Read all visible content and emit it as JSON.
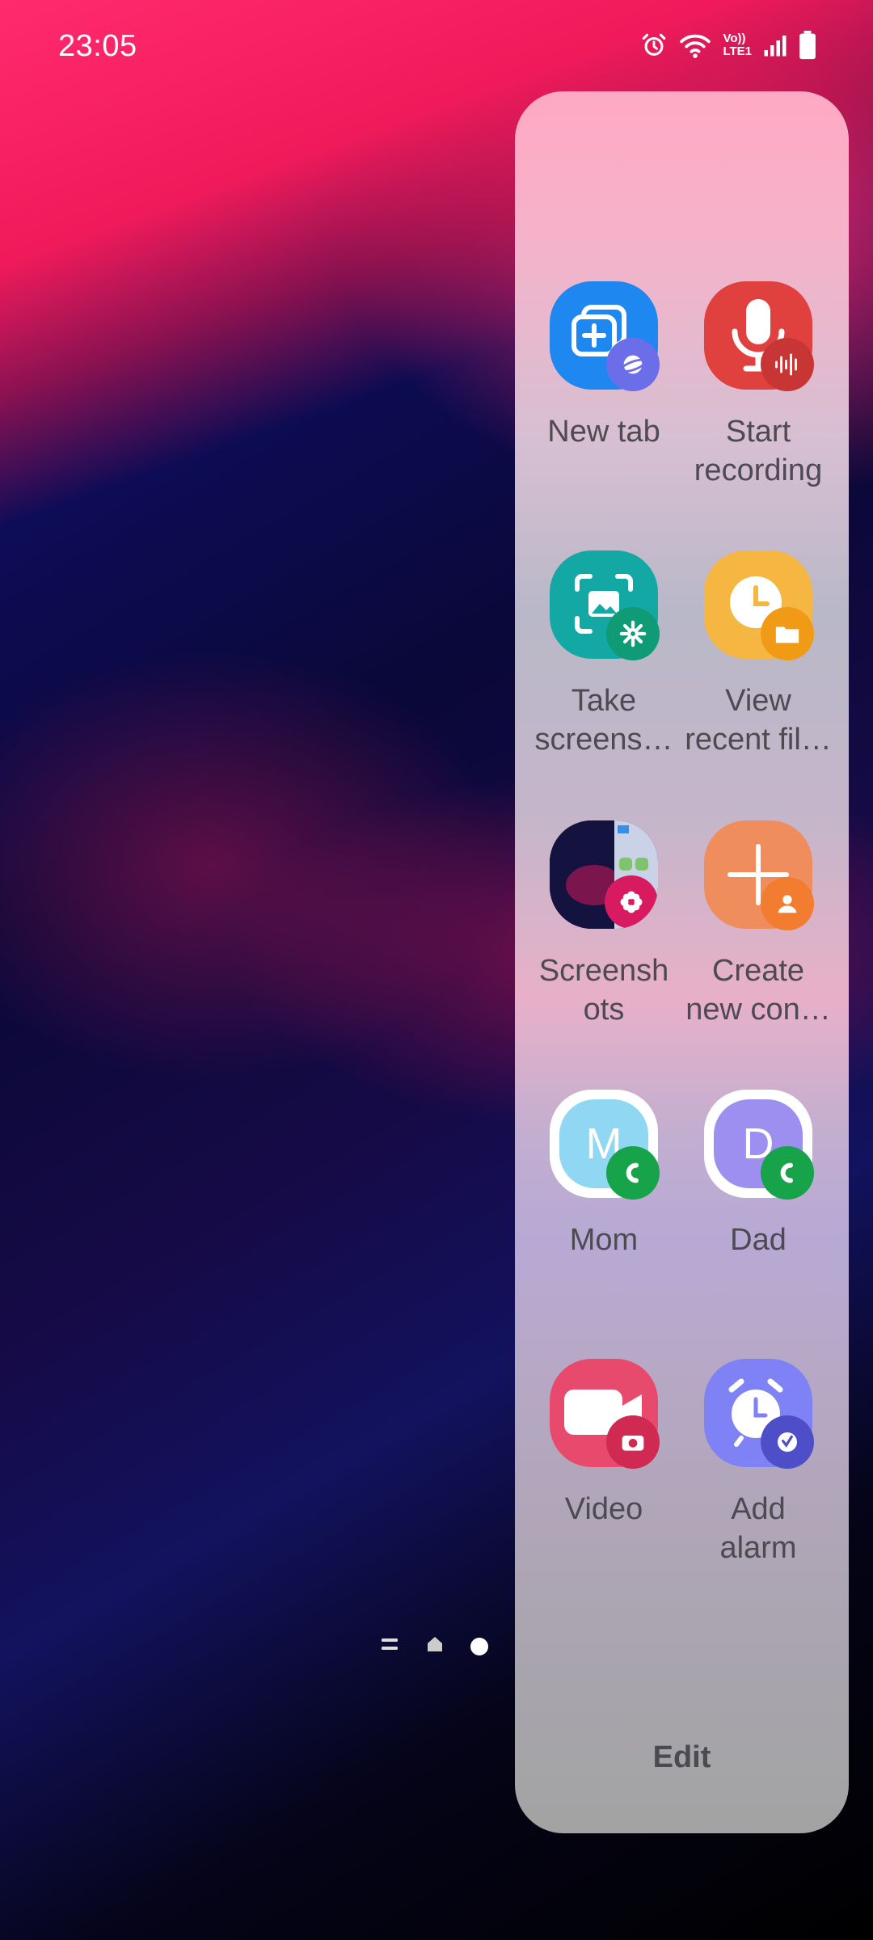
{
  "status_bar": {
    "time": "23:05",
    "icons": [
      "alarm-icon",
      "wifi-icon",
      "volte-icon",
      "signal-icon",
      "battery-icon"
    ],
    "volte_line1": "Vo))",
    "volte_line2": "LTE1"
  },
  "edge_panel": {
    "apps": [
      {
        "label": "New tab",
        "icon": "internet-new-tab-icon",
        "badge": "internet-icon",
        "color": "#1e88f0",
        "badge_color": "#6b6ee8"
      },
      {
        "label": "Start recording",
        "icon": "microphone-icon",
        "badge": "audio-wave-icon",
        "color": "#e0403e",
        "badge_color": "#c73535"
      },
      {
        "label": "Take screens…",
        "icon": "screenshot-icon",
        "badge": "gear-icon",
        "color": "#14a8a4",
        "badge_color": "#0f9b76"
      },
      {
        "label": "View recent fil…",
        "icon": "clock-icon",
        "badge": "folder-icon",
        "color": "#f5b642",
        "badge_color": "#f19a16"
      },
      {
        "label": "Screensh ots",
        "icon": "screenshot-thumbnail-icon",
        "badge": "flower-icon",
        "color": "#1c1450",
        "badge_color": "#d81b60"
      },
      {
        "label": "Create new con…",
        "icon": "plus-icon",
        "badge": "person-icon",
        "color": "#ef8e5c",
        "badge_color": "#f27c2f"
      },
      {
        "label": "Mom",
        "icon": "contact-avatar-icon",
        "initial": "M",
        "badge": "phone-icon",
        "color": "#8fd7f2",
        "badge_color": "#16a34a"
      },
      {
        "label": "Dad",
        "icon": "contact-avatar-icon",
        "initial": "D",
        "badge": "phone-icon",
        "color": "#9c8ff0",
        "badge_color": "#16a34a"
      },
      {
        "label": "Video",
        "icon": "video-camera-icon",
        "badge": "camera-icon",
        "color": "#e84a6e",
        "badge_color": "#d02a52"
      },
      {
        "label": "Add alarm",
        "icon": "alarm-clock-icon",
        "badge": "clock-check-icon",
        "color": "#7f82f5",
        "badge_color": "#4e4fc8"
      }
    ],
    "edit_label": "Edit"
  },
  "colors": {
    "wallpaper_red": "#ff2a6e",
    "wallpaper_blue": "#1a1a8c",
    "label_text": "#4d4a52"
  }
}
